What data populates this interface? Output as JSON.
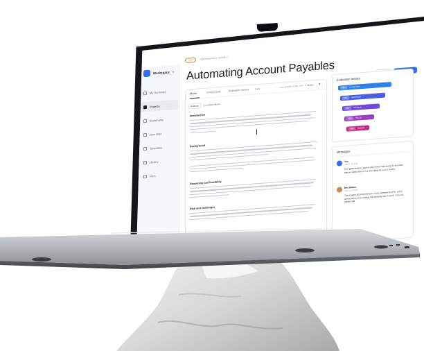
{
  "workspace": {
    "name": "Workspace"
  },
  "sidebar": {
    "items": [
      {
        "label": "My Summary",
        "active": false
      },
      {
        "label": "Projects",
        "active": true
      },
      {
        "label": "Bookmarks",
        "active": false
      },
      {
        "label": "New chat",
        "active": false
      },
      {
        "label": "Templates",
        "active": false
      },
      {
        "label": "History",
        "active": false
      },
      {
        "label": "Files",
        "active": false
      }
    ]
  },
  "topbar": {
    "status": "Draft",
    "updated": "Last Updated 08 14, 2024 08:27",
    "share_label": "Share",
    "update_label": "Update status"
  },
  "page": {
    "title": "Automating Account Payables"
  },
  "doc": {
    "tabs": [
      "Memo",
      "Components",
      "Evaluation metrics",
      "Live"
    ],
    "last_updated": "Last updated 14 May, 2024",
    "history_label": "History",
    "subtabs": [
      "AI Memo",
      "Live Edited Memo"
    ],
    "sections": [
      "Introduction",
      "Background",
      "Reasoning and feasibility",
      "Risk and challenges"
    ]
  },
  "evaluation": {
    "title": "Evaluation metrics",
    "bars": [
      {
        "label": "Configuration",
        "value": "80%",
        "color": "#2f80ed",
        "fraction": 0.8
      },
      {
        "label": "Deficiencies",
        "value": "60%",
        "color": "#4b5fe0",
        "fraction": 0.68
      },
      {
        "label": "Standards",
        "value": "50%",
        "color": "#6d4bd8",
        "fraction": 0.56
      },
      {
        "label": "Security",
        "value": "40%",
        "color": "#9a3fc4",
        "fraction": 0.45
      },
      {
        "label": "Scalable",
        "value": "30%",
        "color": "#c42a86",
        "fraction": 0.34
      }
    ]
  },
  "messages": {
    "title": "Messages",
    "items": [
      {
        "name": "You",
        "time": "2/02/24, 09:15 AM",
        "text": "Hey @BenWilson I have build a basic case study for the case that we talked about. It is now ready for you to review."
      },
      {
        "name": "Ben Wilson",
        "time": "2/02/24, 10:07 AM",
        "text": "This is great @JohnAnderson I have reviewed the RTL and it seems like we are missing the following step 4 and 5. Can you please add"
      }
    ]
  },
  "colors": {
    "accent": "#2f6fec",
    "status": "#d28b2a"
  }
}
